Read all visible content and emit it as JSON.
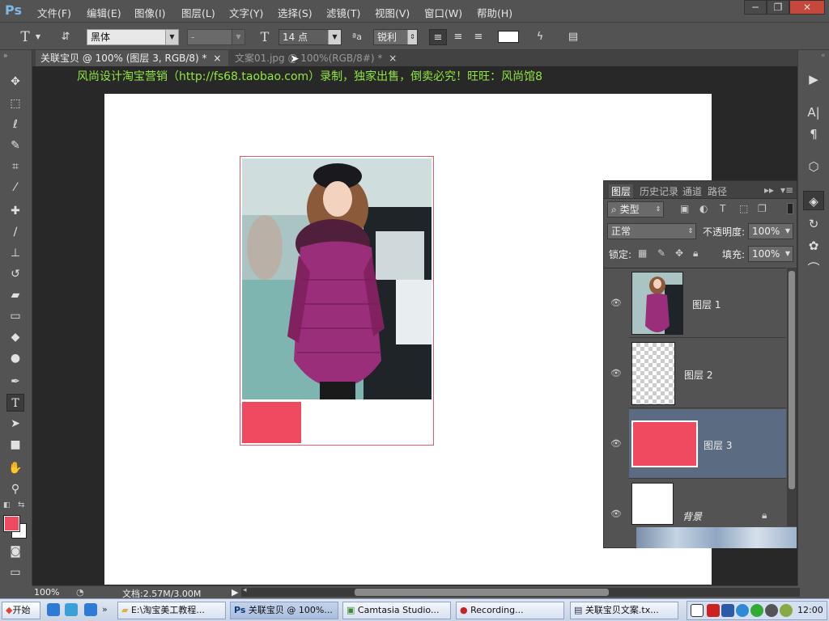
{
  "app": {
    "logo": "Ps"
  },
  "menu": {
    "items": [
      "文件(F)",
      "编辑(E)",
      "图像(I)",
      "图层(L)",
      "文字(Y)",
      "选择(S)",
      "滤镜(T)",
      "视图(V)",
      "窗口(W)",
      "帮助(H)"
    ]
  },
  "window_controls": {
    "minimize": "─",
    "restore": "❐",
    "close": "✕"
  },
  "options_bar": {
    "tool_icon": "T",
    "font_family": "黑体",
    "font_style": "-",
    "font_size": "14 点",
    "antialias": "锐利",
    "color_swatch": "#ffffff"
  },
  "doc_tabs": [
    {
      "label": "关联宝贝 @ 100% (图层 3, RGB/8) *",
      "close": "×",
      "active": true
    },
    {
      "label": "文案01.jpg @ 100%(RGB/8#) *",
      "close": "×",
      "active": false
    }
  ],
  "canvas": {
    "overlay_text": "风尚设计淘宝营销（http://fs68.taobao.com）录制，独家出售，倒卖必究！旺旺：风尚馆8",
    "red_block_color": "#ef4a5f"
  },
  "tools": [
    "move-tool",
    "marquee-tool",
    "lasso-tool",
    "quick-select-tool",
    "crop-tool",
    "eyedropper-tool",
    "healing-tool",
    "brush-tool",
    "stamp-tool",
    "history-brush-tool",
    "eraser-tool",
    "gradient-tool",
    "blur-tool",
    "dodge-tool",
    "pen-tool",
    "type-tool",
    "path-select-tool",
    "shape-tool",
    "hand-tool",
    "zoom-tool"
  ],
  "colors": {
    "foreground": "#ef4a5f",
    "background": "#ffffff",
    "accent": "#5b6b82"
  },
  "layers_panel": {
    "tabs": [
      "图层",
      "历史记录",
      "通道",
      "路径"
    ],
    "filter_label": "类型",
    "blend_mode": "正常",
    "opacity_label": "不透明度:",
    "opacity_value": "100%",
    "lock_label": "锁定:",
    "fill_label": "填充:",
    "fill_value": "100%",
    "layers": [
      {
        "name": "图层 1",
        "selected": false
      },
      {
        "name": "图层 2",
        "selected": false
      },
      {
        "name": "图层 3",
        "selected": true
      },
      {
        "name": "背景",
        "selected": false
      }
    ]
  },
  "status": {
    "zoom": "100%",
    "doc_info": "文档:2.57M/3.00M"
  },
  "taskbar": {
    "start": "开始",
    "buttons": [
      "E:\\淘宝美工教程...",
      "关联宝贝 @ 100%...",
      "Camtasia Studio...",
      "Recording...",
      "关联宝贝文案.tx..."
    ],
    "clock": "12:00"
  }
}
